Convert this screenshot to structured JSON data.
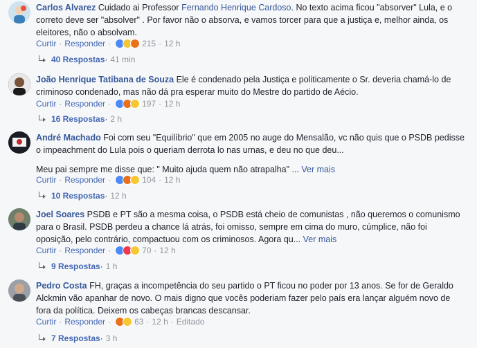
{
  "comments": [
    {
      "author": "Carlos Alvarez",
      "line1_pre": "Cuidado ai Professor ",
      "mention": "Fernando Henrique Cardoso",
      "line1_post": ". No texto acima ficou \"absorver\" Lula, e o",
      "line2": "correto deve ser \"absolver\" . Por favor não o absorva, e vamos torcer para que a justiça e, melhor ainda, os",
      "line3": "eleitores, não o absolvam.",
      "like_label": "Curtir",
      "reply_label": "Responder",
      "reaction_count": "215",
      "time": "12 h",
      "replies_label": "40 Respostas",
      "replies_time": "41 min",
      "reactions": [
        "like-icon",
        "haha-icon",
        "angry-icon"
      ],
      "avatar_color": "#bcd6e8"
    },
    {
      "author": "João Henrique Tatibana de Souza",
      "line1_post": " Ele é condenado pela Justiça e politicamente o Sr. deveria chamá-lo de",
      "line2": "criminoso condenado, mas não dá pra esperar muito do Mestre do partido de Aécio.",
      "like_label": "Curtir",
      "reply_label": "Responder",
      "reaction_count": "197",
      "time": "12 h",
      "replies_label": "16 Respostas",
      "replies_time": "2 h",
      "reactions": [
        "like-icon",
        "angry-icon",
        "haha-icon"
      ],
      "avatar_color": "#3b2a22"
    },
    {
      "author": "André Machado",
      "line1_post": " Foi com seu \"Equilíbrio\" que em 2005 no auge do Mensalão, vc não quis que o PSDB pedisse",
      "line2": "o impeachment do Lula pois o queriam derrota lo nas urnas, e deu no que deu...",
      "line3": "Meu pai sempre me disse que: \" Muito ajuda quem não atrapalha\" ...",
      "more_label": "Ver mais",
      "like_label": "Curtir",
      "reply_label": "Responder",
      "reaction_count": "104",
      "time": "12 h",
      "replies_label": "10 Respostas",
      "replies_time": "12 h",
      "reactions": [
        "like-icon",
        "angry-icon",
        "haha-icon"
      ],
      "avatar_color": "#1d1f2a"
    },
    {
      "author": "Joel Soares",
      "line1_post": " PSDB e PT são a mesma coisa, o PSDB está cheio de comunistas , não queremos o comunismo",
      "line2": "para o Brasil. PSDB perdeu a chance lá atrás, foi omisso, sempre em cima do muro, cúmplice, não foi",
      "line3": "oposição, pelo contrário, compactuou com os criminosos. Agora qu...",
      "more_label": "Ver mais",
      "like_label": "Curtir",
      "reply_label": "Responder",
      "reaction_count": "70",
      "time": "12 h",
      "replies_label": "9 Respostas",
      "replies_time": "1 h",
      "reactions": [
        "like-icon",
        "love-icon",
        "haha-icon"
      ],
      "avatar_color": "#5d6d5e"
    },
    {
      "author": "Pedro Costa",
      "line1_post": " FH, graças a incompetência do seu partido o PT ficou no poder por 13 anos. Se for de Geraldo",
      "line2": "Alckmin vão apanhar de novo. O mais digno que vocês poderiam fazer pelo país era lançar alguém novo de",
      "line3": "fora da política. Deixem os cabeças brancas descansar.",
      "like_label": "Curtir",
      "reply_label": "Responder",
      "reaction_count": "63",
      "time": "12 h",
      "edited": "Editado",
      "replies_label": "7 Respostas",
      "replies_time": "3 h",
      "reactions": [
        "angry-icon",
        "haha-icon"
      ],
      "avatar_color": "#8c8c8c"
    }
  ],
  "separator": "·",
  "colors": {
    "link": "#365899",
    "action": "#4267b2",
    "meta": "#90949c",
    "background": "#f6f7f9"
  }
}
